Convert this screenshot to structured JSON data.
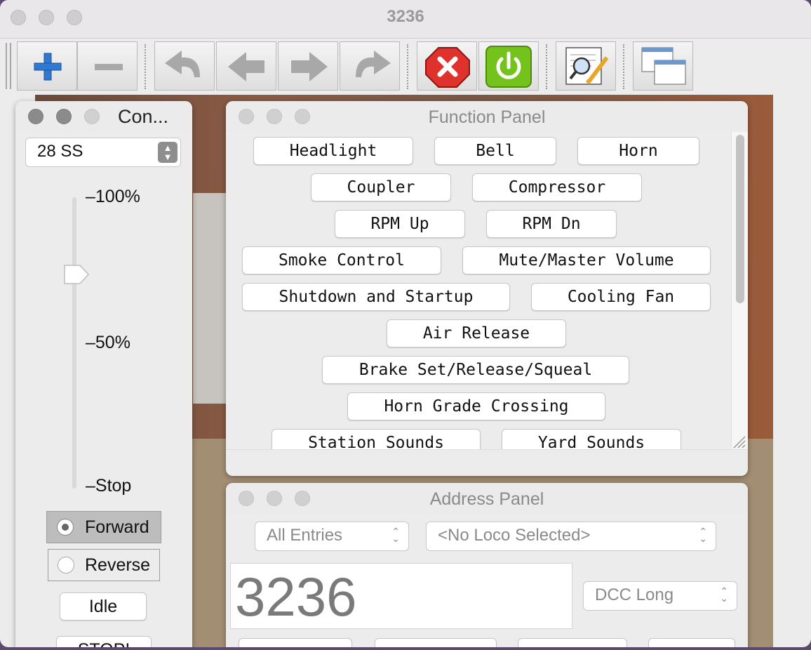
{
  "window": {
    "title": "3236"
  },
  "toolbar": {
    "buttons": [
      "add-button",
      "remove-button",
      "undo-button",
      "back-button",
      "forward-button",
      "redo-button",
      "stop-button",
      "power-button",
      "edit-button",
      "windows-button"
    ]
  },
  "control": {
    "title": "Con...",
    "speed_steps": "28 SS",
    "labels": {
      "max": "100%",
      "mid": "50%",
      "stop": "Stop"
    },
    "speed": 0.73,
    "forward": "Forward",
    "reverse": "Reverse",
    "idle": "Idle",
    "stop_button": "STOP!"
  },
  "function_panel": {
    "title": "Function Panel",
    "rows": [
      [
        "Headlight",
        "Bell",
        "Horn"
      ],
      [
        "Coupler",
        "Compressor"
      ],
      [
        "RPM Up",
        "RPM Dn"
      ],
      [
        "Smoke Control",
        "Mute/Master Volume"
      ],
      [
        "Shutdown and Startup",
        "Cooling Fan"
      ],
      [
        "Air Release"
      ],
      [
        "Brake Set/Release/Squeal"
      ],
      [
        "Horn Grade Crossing"
      ],
      [
        "Station Sounds",
        "Yard Sounds"
      ]
    ]
  },
  "address_panel": {
    "title": "Address Panel",
    "entries_select": "All Entries",
    "loco_select": "<No Loco Selected>",
    "address": "3236",
    "protocol": "DCC Long"
  },
  "colors": {
    "stop_red": "#e0322d",
    "power_green": "#74c21c",
    "plus_blue": "#2f79d3"
  }
}
